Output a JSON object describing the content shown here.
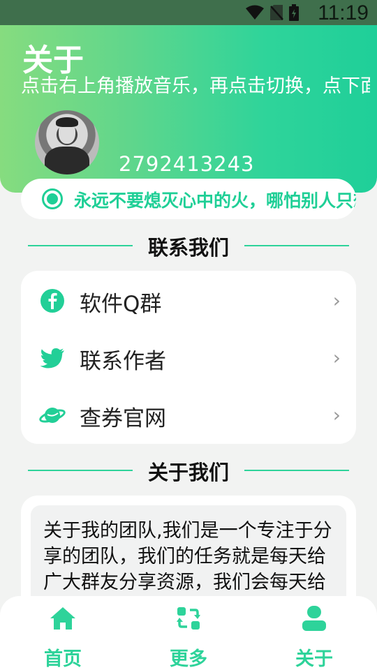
{
  "status_bar": {
    "time": "11:19",
    "icons": [
      "wifi-icon",
      "no-sim-icon",
      "battery-icon"
    ]
  },
  "header": {
    "title": "关于",
    "description": "点击右上角播放音乐，再点击切换，点下面头像停止",
    "qq": "2792413243"
  },
  "motto": {
    "text": "永远不要熄灭心中的火，哪怕别人只想来烤烤手"
  },
  "contact_section": {
    "heading": "联系我们",
    "items": [
      {
        "label": "软件Q群",
        "icon": "facebook-icon"
      },
      {
        "label": "联系作者",
        "icon": "twitter-icon"
      },
      {
        "label": "查券官网",
        "icon": "planet-icon"
      }
    ]
  },
  "about_section": {
    "heading": "关于我们",
    "text": "关于我的团队,我们是一个专注于分享的团队，我们的任务就是每天给广大群友分享资源，我们会每天给大家分享：线报，福利活动"
  },
  "bottom_nav": {
    "items": [
      {
        "label": "首页",
        "icon": "home-icon"
      },
      {
        "label": "更多",
        "icon": "refresh-icon"
      },
      {
        "label": "关于",
        "icon": "user-icon"
      }
    ]
  },
  "colors": {
    "accent": "#2ed39a",
    "header_start": "#86dc7f",
    "header_end": "#1fcf99"
  }
}
